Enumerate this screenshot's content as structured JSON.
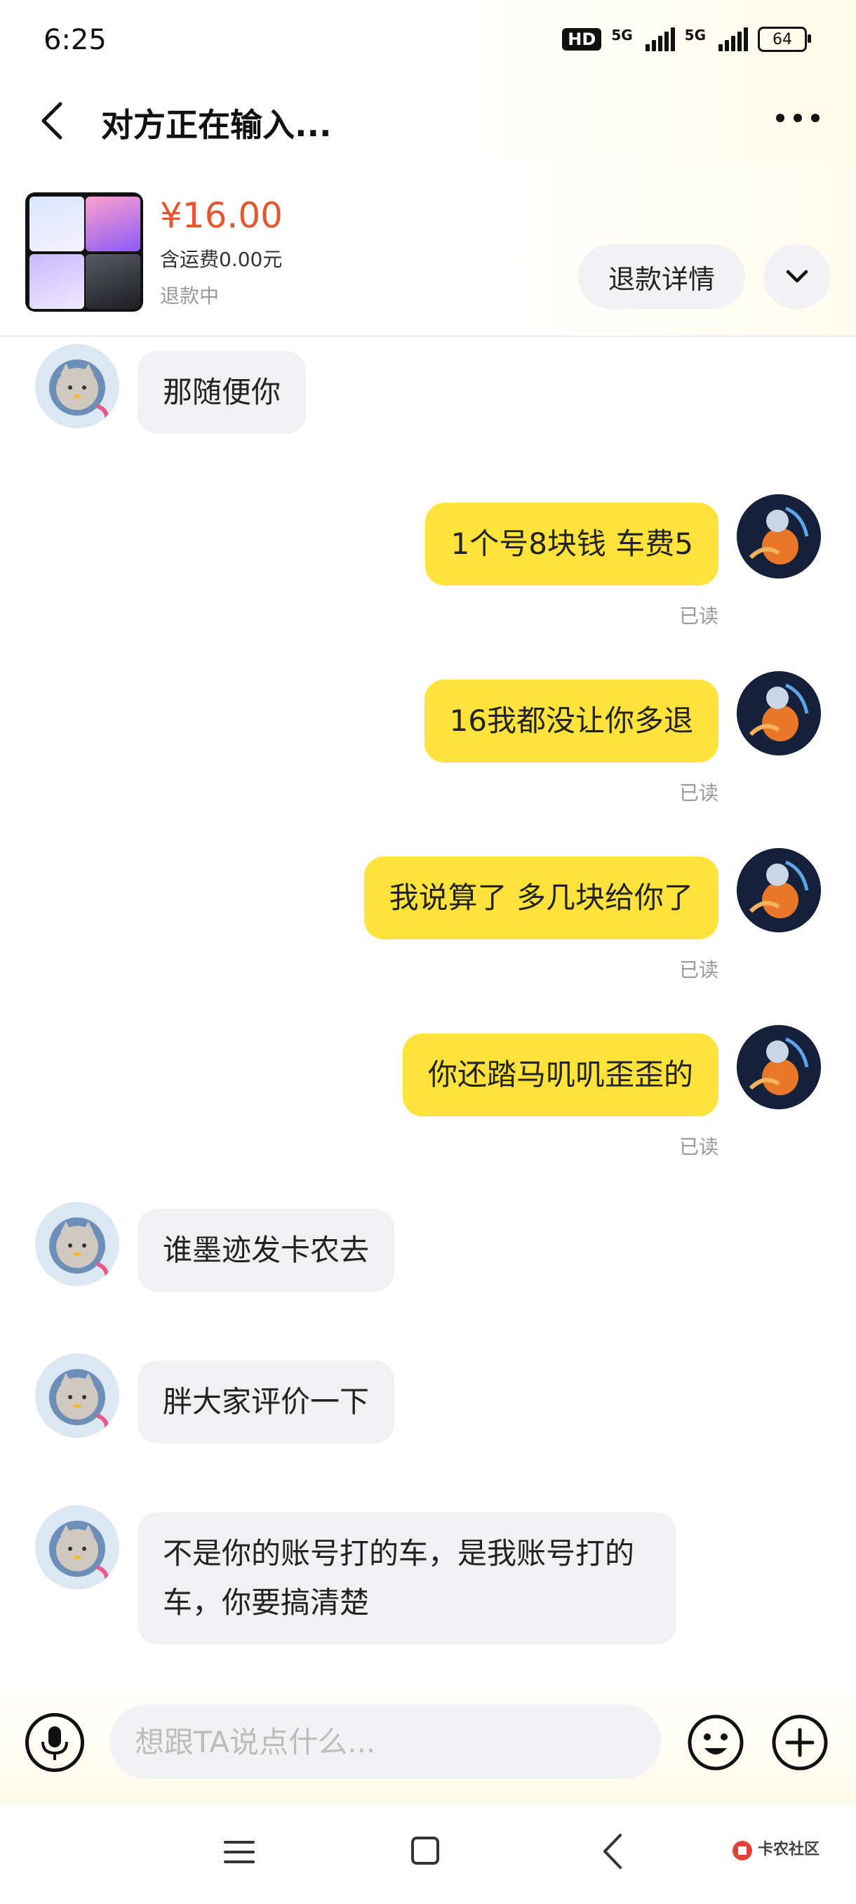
{
  "status_bar": {
    "time": "6:25",
    "hd_label": "HD",
    "signal_1_label": "5G",
    "signal_2_label": "5G",
    "battery": "64"
  },
  "header": {
    "title": "对方正在输入..."
  },
  "order": {
    "price": "¥16.00",
    "shipping": "含运费0.00元",
    "status": "退款中",
    "refund_detail_label": "退款详情"
  },
  "messages": [
    {
      "side": "in",
      "text": "那随便你"
    },
    {
      "side": "out",
      "text": "1个号8块钱 车费5",
      "receipt": "已读"
    },
    {
      "side": "out",
      "text": "16我都没让你多退",
      "receipt": "已读"
    },
    {
      "side": "out",
      "text": "我说算了 多几块给你了",
      "receipt": "已读"
    },
    {
      "side": "out",
      "text": "你还踏马叽叽歪歪的",
      "receipt": "已读"
    },
    {
      "side": "in",
      "text": "谁墨迹发卡农去"
    },
    {
      "side": "in",
      "text": "胖大家评价一下"
    },
    {
      "side": "in",
      "text": "不是你的账号打的车，是我账号打的车，你要搞清楚"
    }
  ],
  "input": {
    "placeholder": "想跟TA说点什么..."
  },
  "watermark": {
    "text": "卡农社区"
  },
  "colors": {
    "price": "#e4572e",
    "outgoing_bubble": "#ffe33b",
    "incoming_bubble": "#f1f1f3"
  }
}
